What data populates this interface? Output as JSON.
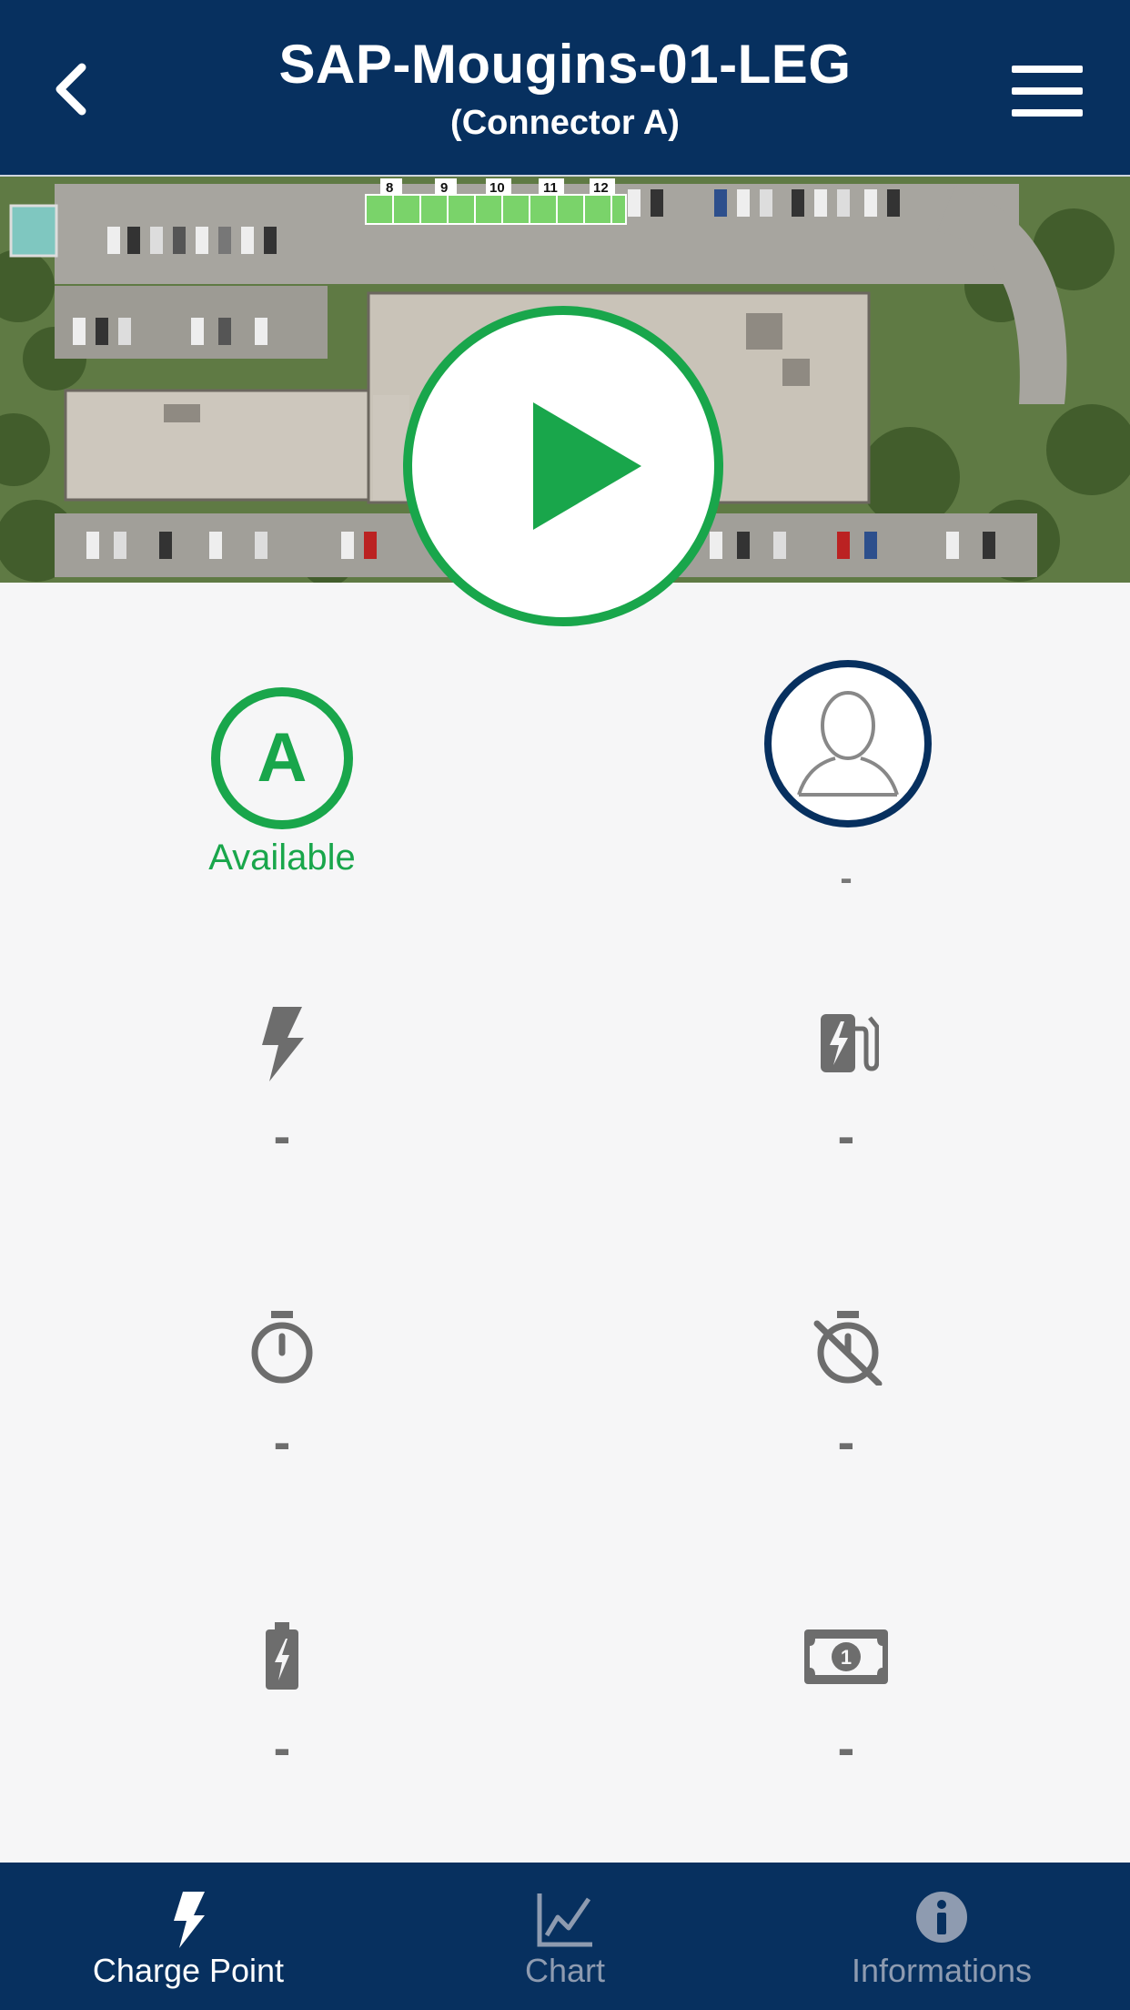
{
  "header": {
    "title": "SAP-Mougins-01-LEG",
    "subtitle": "(Connector A)"
  },
  "connector": {
    "letter": "A",
    "status": "Available",
    "status_color": "#19a64b"
  },
  "user": {
    "name": "-"
  },
  "metrics": {
    "power": "-",
    "energy": "-",
    "duration": "-",
    "inactivity": "-",
    "state_of_charge": "-",
    "price": "-"
  },
  "tabs": [
    {
      "label": "Charge Point",
      "icon": "lightning-icon",
      "active": true
    },
    {
      "label": "Chart",
      "icon": "chart-icon",
      "active": false
    },
    {
      "label": "Informations",
      "icon": "info-icon",
      "active": false
    }
  ],
  "colors": {
    "header_bg": "#07305f",
    "accent_green": "#19a64b",
    "icon_gray": "#6d6d6d"
  }
}
